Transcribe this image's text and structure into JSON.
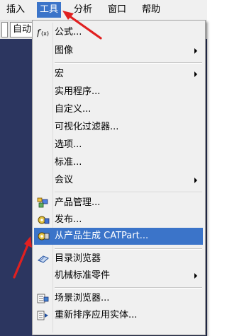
{
  "menubar": {
    "items": [
      "插入",
      "工具",
      "分析",
      "窗口",
      "帮助"
    ]
  },
  "toolbar": {
    "field_text": "自动"
  },
  "menu": {
    "items": [
      {
        "label": "公式..."
      },
      {
        "label": "图像"
      },
      {
        "label": "宏"
      },
      {
        "label": "实用程序..."
      },
      {
        "label": "自定义..."
      },
      {
        "label": "可视化过滤器..."
      },
      {
        "label": "选项..."
      },
      {
        "label": "标准..."
      },
      {
        "label": "会议"
      },
      {
        "label": "产品管理..."
      },
      {
        "label": "发布..."
      },
      {
        "label": "从产品生成 CATPart..."
      },
      {
        "label": "目录浏览器"
      },
      {
        "label": "机械标准零件"
      },
      {
        "label": "场景浏览器..."
      },
      {
        "label": "重新排序应用实体..."
      }
    ]
  },
  "colors": {
    "highlight": "#3b74c9",
    "workspace": "#2c3660",
    "arrow": "#e02020"
  }
}
